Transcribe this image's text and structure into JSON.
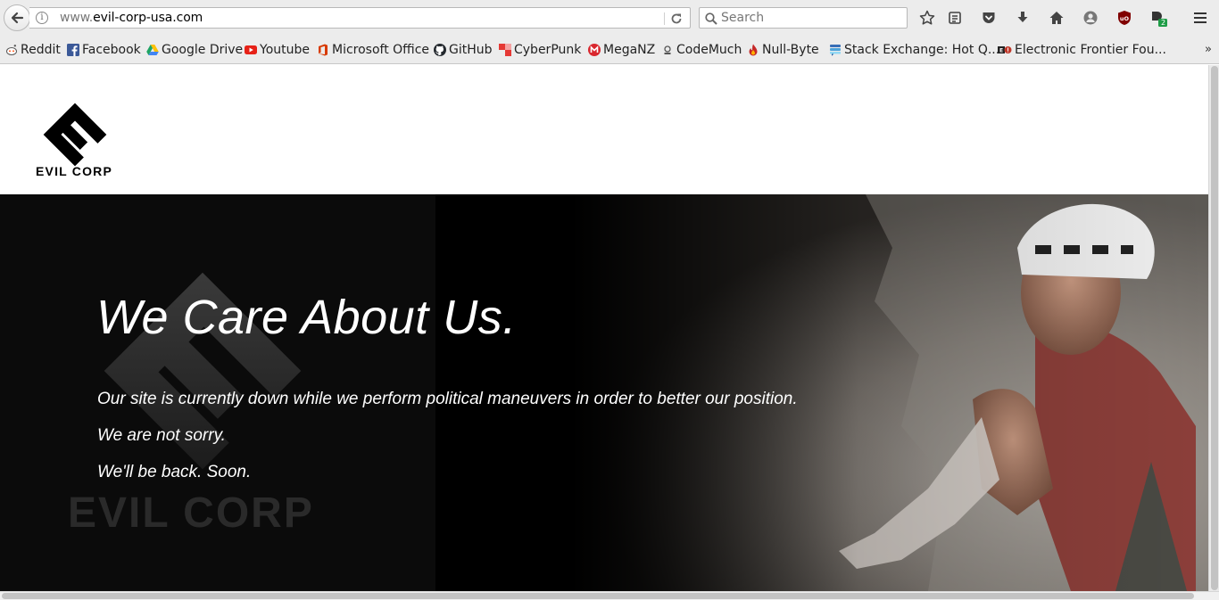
{
  "browser": {
    "url_prefix": "www.",
    "url_domain": "evil-corp-usa.com",
    "search_placeholder": "Search",
    "download_badge": "2"
  },
  "bookmarks": [
    {
      "label": "Reddit",
      "icon": "reddit-icon",
      "color": "#ff4500"
    },
    {
      "label": "Facebook",
      "icon": "facebook-icon",
      "color": "#3b5998"
    },
    {
      "label": "Google Drive",
      "icon": "google-drive-icon",
      "color": "#1fa463"
    },
    {
      "label": "Youtube",
      "icon": "youtube-icon",
      "color": "#e62117"
    },
    {
      "label": "Microsoft Office",
      "icon": "office-icon",
      "color": "#d83b01"
    },
    {
      "label": "GitHub",
      "icon": "github-icon",
      "color": "#24292e"
    },
    {
      "label": "CyberPunk",
      "icon": "cyberpunk-icon",
      "color": "#e53935"
    },
    {
      "label": "MegaNZ",
      "icon": "mega-icon",
      "color": "#d9272e"
    },
    {
      "label": "CodeMuch",
      "icon": "codemuch-icon",
      "color": "#555555"
    },
    {
      "label": "Null-Byte",
      "icon": "null-byte-icon",
      "color": "#c62828"
    },
    {
      "label": "Stack Exchange: Hot Q...",
      "icon": "stack-exchange-icon",
      "color": "#1e5397"
    },
    {
      "label": "Electronic Frontier Fou...",
      "icon": "eff-icon",
      "color": "#c0392b"
    }
  ],
  "bookmarks_overflow": "»",
  "page": {
    "logo_text": "EVIL CORP",
    "watermark_text": "EVIL CORP",
    "hero_title": "We Care About Us.",
    "hero_lines": [
      "Our site is currently down while we perform political maneuvers in order to better our position.",
      "We are not sorry.",
      "We'll be back. Soon."
    ]
  },
  "colors": {
    "toolbar_bg": "#ececec",
    "hero_bg": "#000000",
    "text_on_hero": "#ffffff",
    "ublock_red": "#800000",
    "badge_green": "#1e9c46"
  }
}
